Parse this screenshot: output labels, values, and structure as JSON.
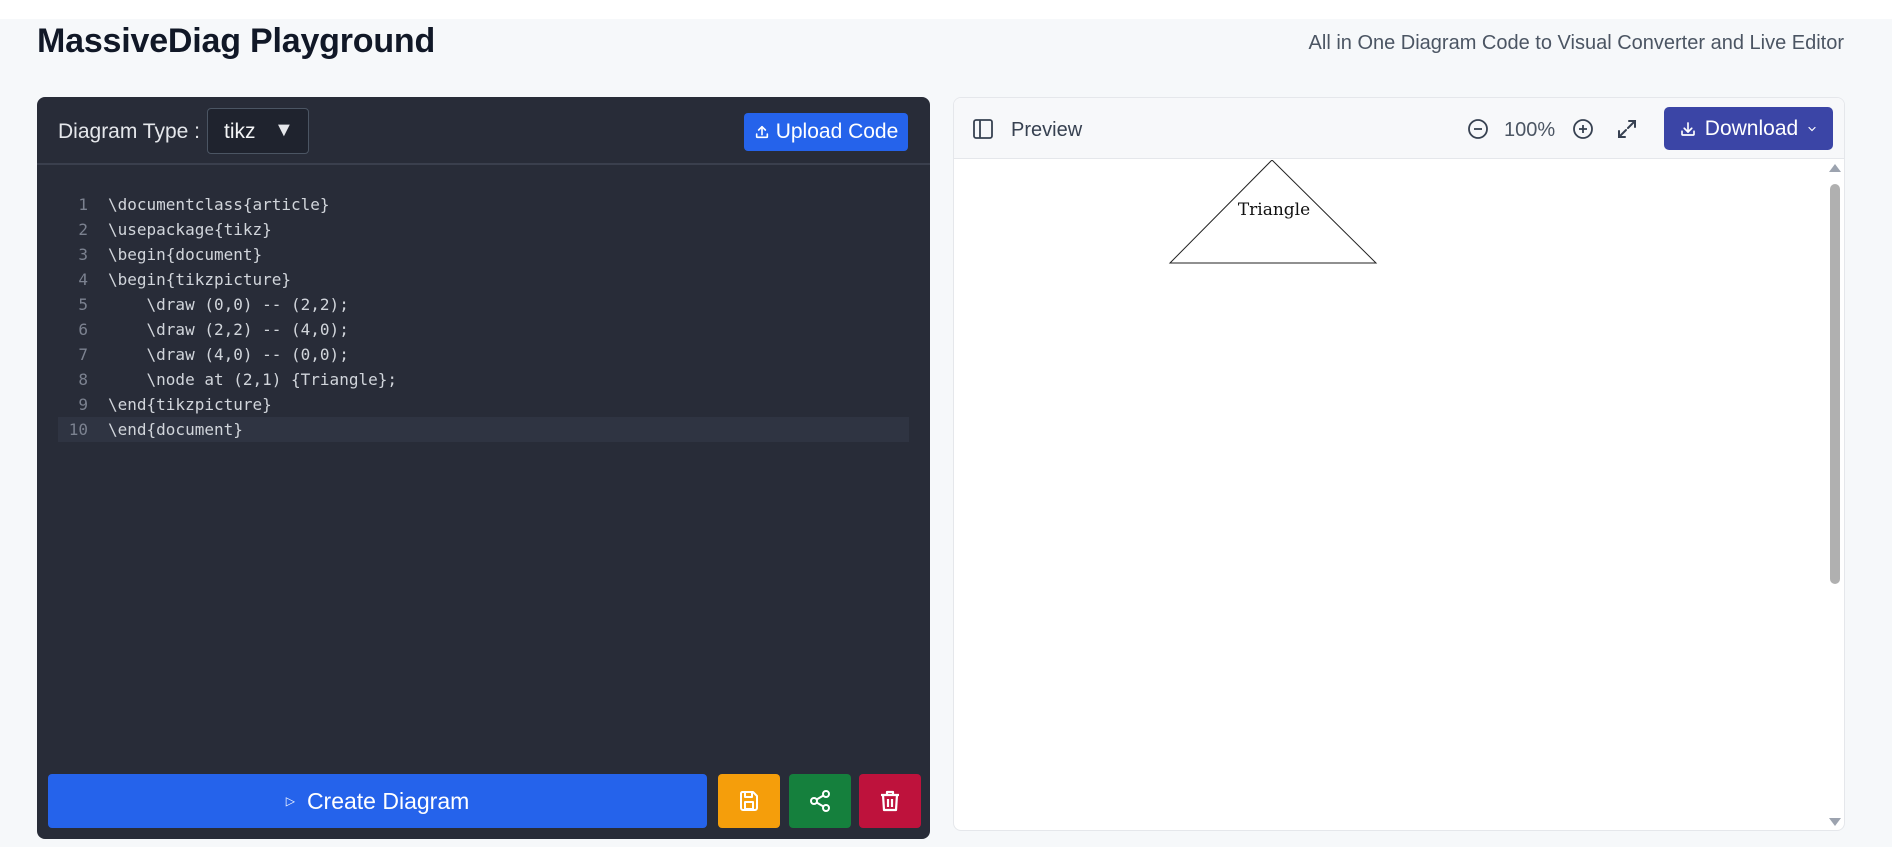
{
  "header": {
    "title": "MassiveDiag Playground",
    "subtitle": "All in One Diagram Code to Visual Converter and Live Editor"
  },
  "editor": {
    "diagram_type_label": "Diagram Type :",
    "diagram_type_value": "tikz",
    "upload_label": "Upload Code",
    "lines": [
      {
        "n": "1",
        "text": "\\documentclass{article}"
      },
      {
        "n": "2",
        "text": "\\usepackage{tikz}"
      },
      {
        "n": "3",
        "text": "\\begin{document}"
      },
      {
        "n": "4",
        "text": "\\begin{tikzpicture}"
      },
      {
        "n": "5",
        "text": "    \\draw (0,0) -- (2,2);"
      },
      {
        "n": "6",
        "text": "    \\draw (2,2) -- (4,0);"
      },
      {
        "n": "7",
        "text": "    \\draw (4,0) -- (0,0);"
      },
      {
        "n": "8",
        "text": "    \\node at (2,1) {Triangle};"
      },
      {
        "n": "9",
        "text": "\\end{tikzpicture}"
      },
      {
        "n": "10",
        "text": "\\end{document}"
      }
    ],
    "create_label": "Create Diagram"
  },
  "preview": {
    "label": "Preview",
    "zoom": "100%",
    "download_label": "Download",
    "diagram_text": "Triangle"
  },
  "colors": {
    "editor_bg": "#282c38",
    "primary": "#2563eb",
    "save": "#f59e0b",
    "share": "#15803d",
    "delete": "#be123c",
    "download": "#3b45a6"
  }
}
